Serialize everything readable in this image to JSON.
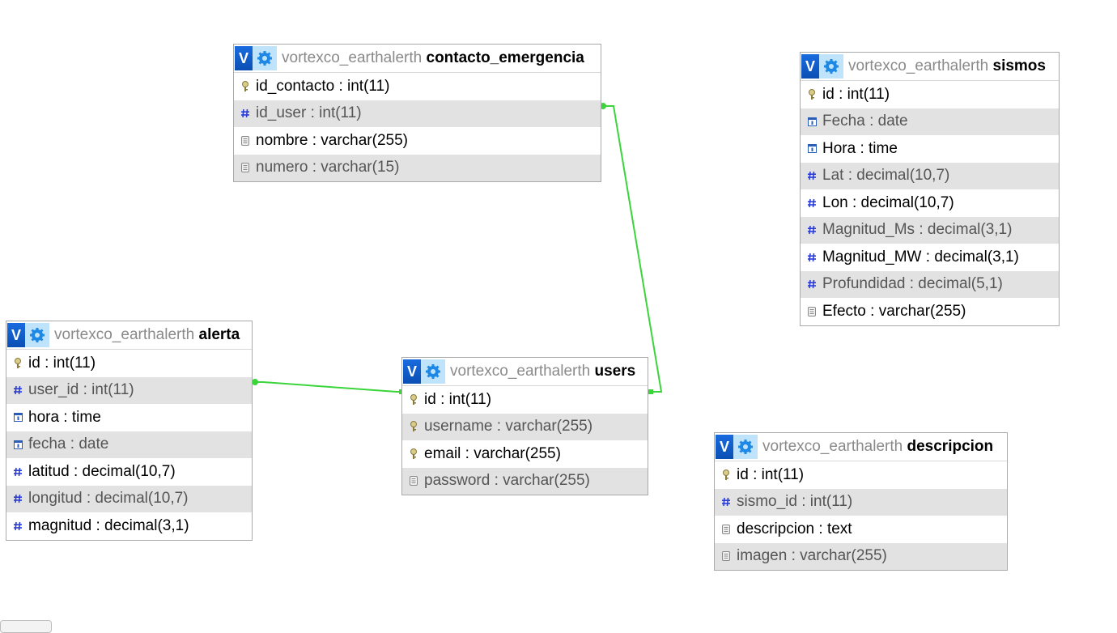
{
  "colors": {
    "relation_line": "#3bd43b",
    "toggle": "#1a6be0",
    "gear_bg": "#bfe3fb",
    "stripe": "#e2e2e2",
    "key_icon": "#b8a75a",
    "num_icon": "#2b3cd6"
  },
  "tables": [
    {
      "db": "vortexco_earthalerth",
      "name": "contacto_emergencia",
      "toggle": "V",
      "columns": [
        {
          "text": "id_contacto : int(11)",
          "icon": "key-icon"
        },
        {
          "text": "id_user : int(11)",
          "icon": "hash-icon"
        },
        {
          "text": "nombre : varchar(255)",
          "icon": "text-icon"
        },
        {
          "text": "numero : varchar(15)",
          "icon": "text-icon"
        }
      ]
    },
    {
      "db": "vortexco_earthalerth",
      "name": "sismos",
      "toggle": "V",
      "columns": [
        {
          "text": "id : int(11)",
          "icon": "key-icon"
        },
        {
          "text": "Fecha : date",
          "icon": "calendar-icon"
        },
        {
          "text": "Hora : time",
          "icon": "calendar-icon"
        },
        {
          "text": "Lat : decimal(10,7)",
          "icon": "hash-icon"
        },
        {
          "text": "Lon : decimal(10,7)",
          "icon": "hash-icon"
        },
        {
          "text": "Magnitud_Ms : decimal(3,1)",
          "icon": "hash-icon"
        },
        {
          "text": "Magnitud_MW : decimal(3,1)",
          "icon": "hash-icon"
        },
        {
          "text": "Profundidad : decimal(5,1)",
          "icon": "hash-icon"
        },
        {
          "text": "Efecto : varchar(255)",
          "icon": "text-icon"
        }
      ]
    },
    {
      "db": "vortexco_earthalerth",
      "name": "alerta",
      "toggle": "V",
      "columns": [
        {
          "text": "id : int(11)",
          "icon": "key-icon"
        },
        {
          "text": "user_id : int(11)",
          "icon": "hash-icon"
        },
        {
          "text": "hora : time",
          "icon": "calendar-icon"
        },
        {
          "text": "fecha : date",
          "icon": "calendar-icon"
        },
        {
          "text": "latitud : decimal(10,7)",
          "icon": "hash-icon"
        },
        {
          "text": "longitud : decimal(10,7)",
          "icon": "hash-icon"
        },
        {
          "text": "magnitud : decimal(3,1)",
          "icon": "hash-icon"
        }
      ]
    },
    {
      "db": "vortexco_earthalerth",
      "name": "users",
      "toggle": "V",
      "columns": [
        {
          "text": "id : int(11)",
          "icon": "key-icon"
        },
        {
          "text": "username : varchar(255)",
          "icon": "key-icon"
        },
        {
          "text": "email : varchar(255)",
          "icon": "key-icon"
        },
        {
          "text": "password : varchar(255)",
          "icon": "text-icon"
        }
      ]
    },
    {
      "db": "vortexco_earthalerth",
      "name": "descripcion",
      "toggle": "V",
      "columns": [
        {
          "text": "id : int(11)",
          "icon": "key-icon"
        },
        {
          "text": "sismo_id : int(11)",
          "icon": "hash-icon"
        },
        {
          "text": "descripcion : text",
          "icon": "text-icon"
        },
        {
          "text": "imagen : varchar(255)",
          "icon": "text-icon"
        }
      ]
    }
  ]
}
